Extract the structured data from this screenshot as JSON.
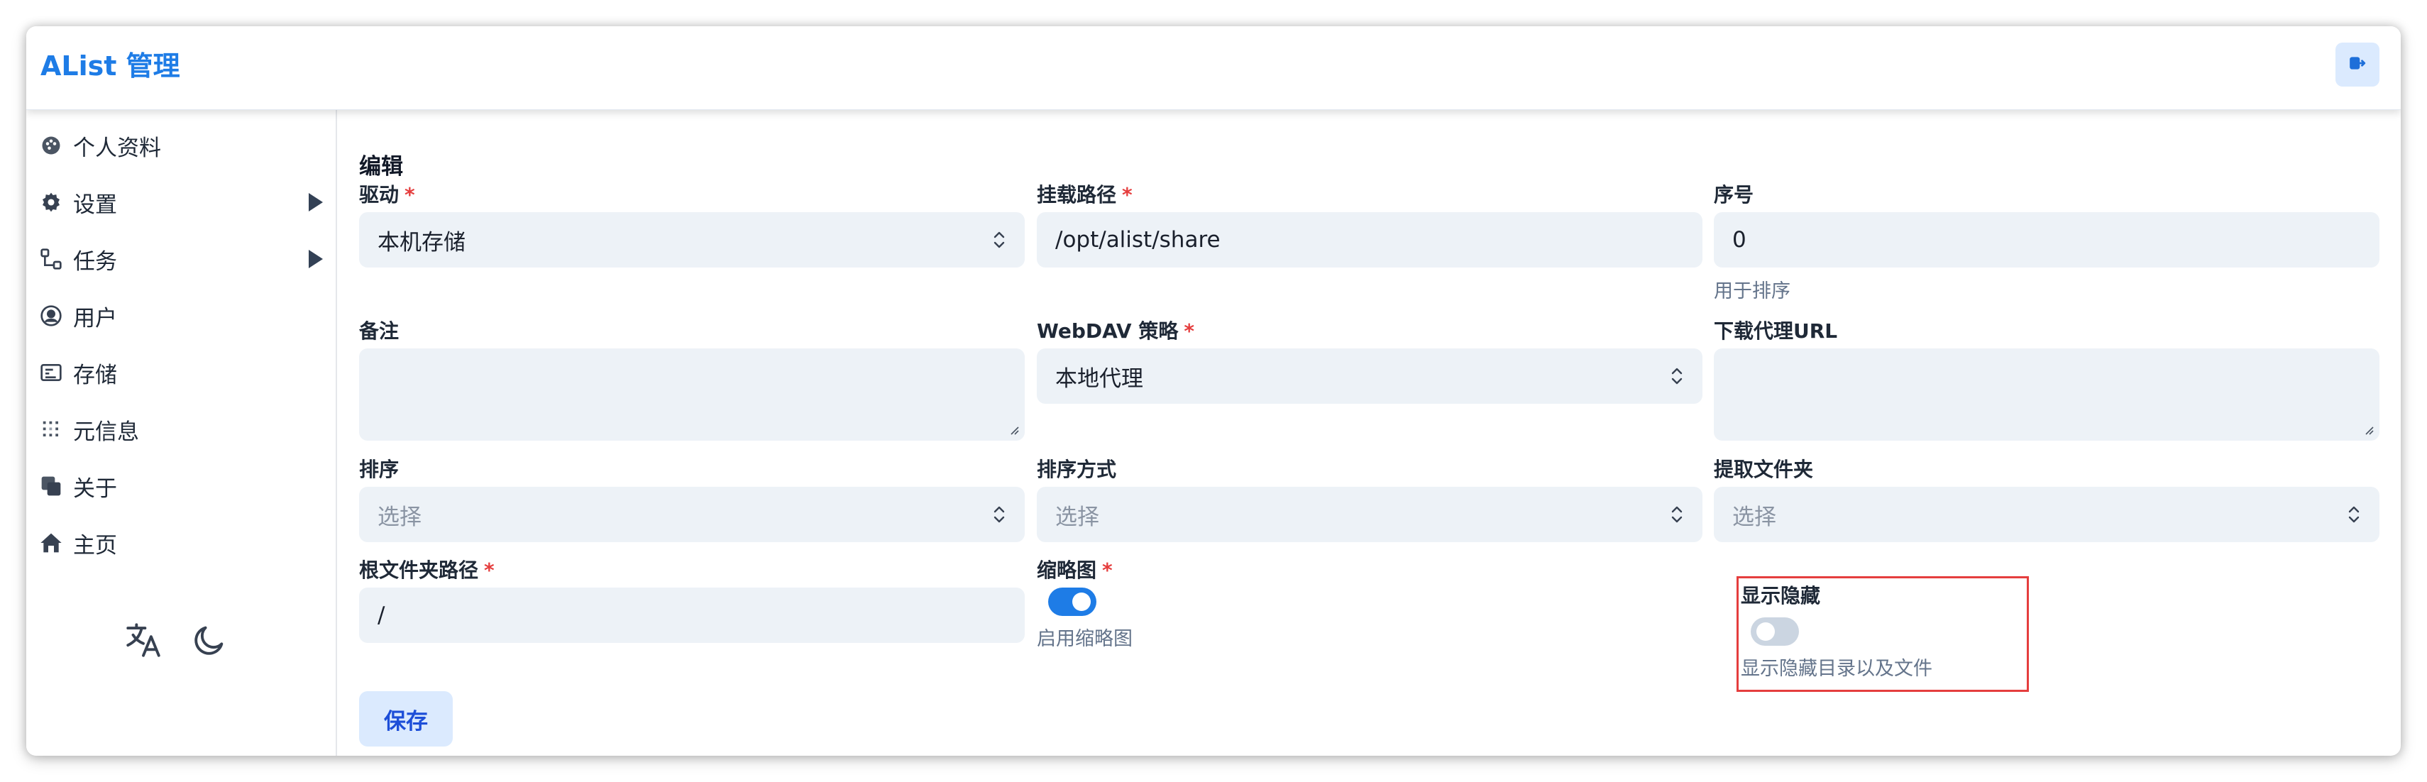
{
  "app": {
    "title": "AList 管理"
  },
  "colors": {
    "accent": "#1e7ce6",
    "required": "#e53e3e",
    "input_bg": "#edf2f7"
  },
  "header": {
    "logout_icon": "logout-icon"
  },
  "sidebar": {
    "items": [
      {
        "label": "个人资料",
        "icon": "profile-icon",
        "expandable": false
      },
      {
        "label": "设置",
        "icon": "gear-icon",
        "expandable": true
      },
      {
        "label": "任务",
        "icon": "tasks-icon",
        "expandable": true
      },
      {
        "label": "用户",
        "icon": "user-icon",
        "expandable": false
      },
      {
        "label": "存储",
        "icon": "storage-icon",
        "expandable": false
      },
      {
        "label": "元信息",
        "icon": "meta-icon",
        "expandable": false
      },
      {
        "label": "关于",
        "icon": "about-icon",
        "expandable": false
      },
      {
        "label": "主页",
        "icon": "home-icon",
        "expandable": false
      }
    ],
    "tools": [
      "translate-icon",
      "moon-icon"
    ]
  },
  "main": {
    "title": "编辑",
    "fields": {
      "driver": {
        "label": "驱动",
        "required": true,
        "value": "本机存储"
      },
      "mount_path": {
        "label": "挂载路径",
        "required": true,
        "value": "/opt/alist/share"
      },
      "order": {
        "label": "序号",
        "value": "0",
        "help": "用于排序"
      },
      "remark": {
        "label": "备注",
        "value": ""
      },
      "webdav_policy": {
        "label": "WebDAV 策略",
        "required": true,
        "value": "本地代理"
      },
      "download_proxy_url": {
        "label": "下载代理URL",
        "value": ""
      },
      "order_by": {
        "label": "排序",
        "placeholder": "选择"
      },
      "order_direction": {
        "label": "排序方式",
        "placeholder": "选择"
      },
      "extract_folder": {
        "label": "提取文件夹",
        "placeholder": "选择"
      },
      "root_folder_path": {
        "label": "根文件夹路径",
        "required": true,
        "value": "/"
      },
      "thumbnail": {
        "label": "缩略图",
        "required": true,
        "enabled": true,
        "help": "启用缩略图"
      },
      "show_hidden": {
        "label": "显示隐藏",
        "enabled": false,
        "help": "显示隐藏目录以及文件"
      }
    },
    "save_label": "保存"
  }
}
